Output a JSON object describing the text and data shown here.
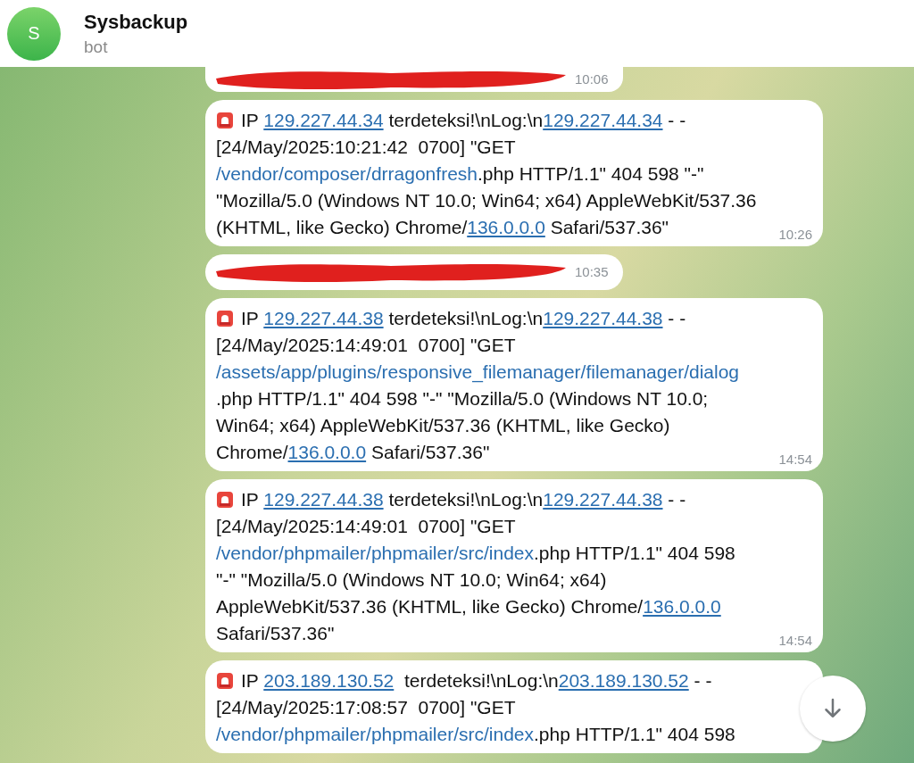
{
  "header": {
    "avatar_letter": "S",
    "title": "Sysbackup",
    "subtitle": "bot"
  },
  "messages": [
    {
      "kind": "redacted",
      "time": "10:06"
    },
    {
      "kind": "log",
      "time": "10:26",
      "lines": [
        [
          {
            "kind": "siren"
          },
          {
            "kind": "text",
            "text": "IP "
          },
          {
            "kind": "link",
            "text": "129.227.44.34"
          },
          {
            "kind": "text",
            "text": " terdeteksi!\\nLog:\\n"
          },
          {
            "kind": "link",
            "text": "129.227.44.34"
          },
          {
            "kind": "text",
            "text": " - -"
          }
        ],
        [
          {
            "kind": "text",
            "text": "[24/May/2025:10:21:42  0700] \"GET"
          }
        ],
        [
          {
            "kind": "path",
            "text": "/vendor/composer/drragonfresh"
          },
          {
            "kind": "text",
            "text": ".php HTTP/1.1\" 404 598 \"-\""
          }
        ],
        [
          {
            "kind": "text",
            "text": "\"Mozilla/5.0 (Windows NT 10.0; Win64; x64) AppleWebKit/537.36"
          }
        ],
        [
          {
            "kind": "text",
            "text": "(KHTML, like Gecko) Chrome/"
          },
          {
            "kind": "link",
            "text": "136.0.0.0"
          },
          {
            "kind": "text",
            "text": " Safari/537.36\""
          }
        ]
      ]
    },
    {
      "kind": "redacted",
      "time": "10:35"
    },
    {
      "kind": "log",
      "time": "14:54",
      "lines": [
        [
          {
            "kind": "siren"
          },
          {
            "kind": "text",
            "text": "IP "
          },
          {
            "kind": "link",
            "text": "129.227.44.38"
          },
          {
            "kind": "text",
            "text": " terdeteksi!\\nLog:\\n"
          },
          {
            "kind": "link",
            "text": "129.227.44.38"
          },
          {
            "kind": "text",
            "text": " - -"
          }
        ],
        [
          {
            "kind": "text",
            "text": "[24/May/2025:14:49:01  0700] \"GET"
          }
        ],
        [
          {
            "kind": "path",
            "text": "/assets/app/plugins/responsive_filemanager/filemanager/dialog"
          }
        ],
        [
          {
            "kind": "text",
            "text": ".php HTTP/1.1\" 404 598 \"-\" \"Mozilla/5.0 (Windows NT 10.0;"
          }
        ],
        [
          {
            "kind": "text",
            "text": "Win64; x64) AppleWebKit/537.36 (KHTML, like Gecko)"
          }
        ],
        [
          {
            "kind": "text",
            "text": "Chrome/"
          },
          {
            "kind": "link",
            "text": "136.0.0.0"
          },
          {
            "kind": "text",
            "text": " Safari/537.36\""
          }
        ]
      ]
    },
    {
      "kind": "log",
      "time": "14:54",
      "lines": [
        [
          {
            "kind": "siren"
          },
          {
            "kind": "text",
            "text": "IP "
          },
          {
            "kind": "link",
            "text": "129.227.44.38"
          },
          {
            "kind": "text",
            "text": " terdeteksi!\\nLog:\\n"
          },
          {
            "kind": "link",
            "text": "129.227.44.38"
          },
          {
            "kind": "text",
            "text": " - -"
          }
        ],
        [
          {
            "kind": "text",
            "text": "[24/May/2025:14:49:01  0700] \"GET"
          }
        ],
        [
          {
            "kind": "path",
            "text": "/vendor/phpmailer/phpmailer/src/index"
          },
          {
            "kind": "text",
            "text": ".php HTTP/1.1\" 404 598"
          }
        ],
        [
          {
            "kind": "text",
            "text": "\"-\" \"Mozilla/5.0 (Windows NT 10.0; Win64; x64)"
          }
        ],
        [
          {
            "kind": "text",
            "text": "AppleWebKit/537.36 (KHTML, like Gecko) Chrome/"
          },
          {
            "kind": "link",
            "text": "136.0.0.0"
          }
        ],
        [
          {
            "kind": "text",
            "text": "Safari/537.36\""
          }
        ]
      ]
    },
    {
      "kind": "log",
      "lines": [
        [
          {
            "kind": "siren"
          },
          {
            "kind": "text",
            "text": "IP "
          },
          {
            "kind": "link",
            "text": "203.189.130.52"
          },
          {
            "kind": "text",
            "text": "  terdeteksi!\\nLog:\\n"
          },
          {
            "kind": "link",
            "text": "203.189.130.52"
          },
          {
            "kind": "text",
            "text": " - -"
          }
        ],
        [
          {
            "kind": "text",
            "text": "[24/May/2025:17:08:57  0700] \"GET"
          }
        ],
        [
          {
            "kind": "path",
            "text": "/vendor/phpmailer/phpmailer/src/index"
          },
          {
            "kind": "text",
            "text": ".php HTTP/1.1\" 404 598"
          }
        ]
      ]
    }
  ]
}
